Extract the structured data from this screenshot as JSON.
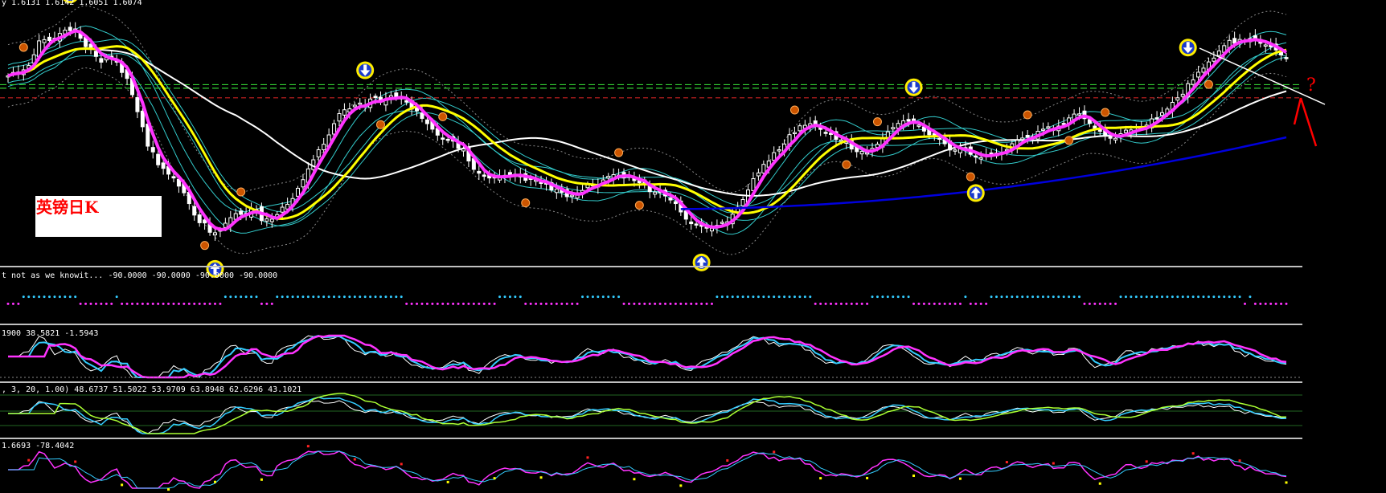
{
  "header": {
    "main_readout": "y  1.6131 1.6142 1.6051 1.6074",
    "chart_label": "英镑日K",
    "question_mark": "?"
  },
  "panes": {
    "p1": "t not as we knowit...  -90.0000 -90.0000 -90.0000 -90.0000",
    "p2": "1900 38.5821 -1.5943",
    "p3": ", 3, 20, 1.00) 48.6737 51.5022 53.9709 63.8948 62.6296 43.1021",
    "p4": "1.6693 -78.4042"
  },
  "colors": {
    "background": "#000000",
    "candle": "#ffffff",
    "ma_magenta": "#ff33ff",
    "ma_yellow": "#ffff00",
    "ma_white": "#ffffff",
    "ma_blue": "#0000dd",
    "band_cyan": "#33cccc",
    "band_gray": "#888888",
    "level_green": "#33cc33",
    "level_red": "#cc2222",
    "separator": "#c0c0c0",
    "arrow_fill": "#1a3acc",
    "arrow_ring": "#ffee00",
    "signal_red": "#ff2222"
  },
  "chart_data": {
    "type": "line",
    "title": "英镑日K",
    "header_values": {
      "open": 1.6131,
      "high": 1.6142,
      "low": 1.6051,
      "close": 1.6074
    },
    "x": [
      0,
      1,
      2,
      3,
      4,
      5,
      6,
      7,
      8,
      9,
      10,
      11,
      12,
      13,
      14,
      15,
      16,
      17,
      18,
      19,
      20,
      21,
      22,
      23,
      24,
      25,
      26,
      27,
      28,
      29,
      30,
      31,
      32,
      33,
      34,
      35,
      36,
      37,
      38,
      39,
      40,
      41,
      42,
      43,
      44,
      45,
      46,
      47,
      48,
      49,
      50,
      51,
      52,
      53,
      54,
      55,
      56,
      57,
      58,
      59,
      60,
      61,
      62,
      63,
      64,
      65,
      66,
      67,
      68,
      69,
      70,
      71,
      72,
      73,
      74,
      75,
      76,
      77,
      78,
      79,
      80,
      81,
      82,
      83,
      84,
      85,
      86,
      87,
      88,
      89,
      90,
      91,
      92,
      93,
      94,
      95,
      96,
      97,
      98,
      99,
      100,
      101,
      102,
      103,
      104,
      105,
      106,
      107,
      108,
      109,
      110,
      111,
      112,
      113,
      114,
      115,
      116,
      117,
      118,
      119,
      120,
      121,
      122,
      123,
      124,
      125,
      126,
      127,
      128,
      129,
      130,
      131,
      132,
      133,
      134,
      135,
      136,
      137,
      138,
      139,
      140,
      141,
      142,
      143,
      144,
      145,
      146,
      147,
      148,
      149,
      150,
      151,
      152,
      153,
      154,
      155,
      156,
      157,
      158,
      159,
      160,
      161,
      162,
      163,
      164,
      165,
      166,
      167,
      168,
      169,
      170,
      171,
      172,
      173,
      174,
      175,
      176,
      177,
      178,
      179,
      180,
      181,
      182,
      183,
      184,
      185,
      186,
      187,
      188,
      189,
      190,
      191,
      192,
      193,
      194,
      195,
      196,
      197,
      198,
      199,
      200,
      201,
      202,
      203,
      204,
      205,
      206,
      207,
      208,
      209,
      210,
      211,
      212,
      213,
      214,
      215,
      216,
      217,
      218,
      219,
      220,
      221,
      222,
      223,
      224,
      225,
      226,
      227,
      228,
      229,
      230,
      231,
      232,
      233,
      234,
      235,
      236,
      237,
      238,
      239,
      240,
      241,
      242,
      243,
      244,
      245,
      246,
      247,
      248,
      249,
      250,
      251,
      252,
      253,
      254,
      255,
      256,
      257,
      258,
      259
    ],
    "close": [
      0.757,
      0.771,
      0.773,
      0.782,
      0.8,
      0.845,
      0.903,
      0.908,
      0.904,
      0.914,
      0.934,
      0.948,
      0.946,
      0.953,
      0.914,
      0.879,
      0.867,
      0.838,
      0.814,
      0.833,
      0.83,
      0.819,
      0.771,
      0.746,
      0.678,
      0.607,
      0.544,
      0.463,
      0.439,
      0.385,
      0.37,
      0.346,
      0.33,
      0.296,
      0.268,
      0.223,
      0.175,
      0.143,
      0.142,
      0.103,
      0.101,
      0.114,
      0.141,
      0.164,
      0.181,
      0.178,
      0.178,
      0.2,
      0.198,
      0.152,
      0.159,
      0.158,
      0.177,
      0.208,
      0.22,
      0.244,
      0.287,
      0.323,
      0.368,
      0.406,
      0.448,
      0.471,
      0.51,
      0.557,
      0.599,
      0.615,
      0.619,
      0.634,
      0.643,
      0.629,
      0.66,
      0.666,
      0.647,
      0.661,
      0.674,
      0.67,
      0.664,
      0.647,
      0.618,
      0.611,
      0.579,
      0.557,
      0.534,
      0.509,
      0.492,
      0.491,
      0.484,
      0.454,
      0.452,
      0.401,
      0.366,
      0.35,
      0.337,
      0.33,
      0.333,
      0.338,
      0.341,
      0.337,
      0.346,
      0.344,
      0.32,
      0.324,
      0.321,
      0.308,
      0.304,
      0.28,
      0.284,
      0.27,
      0.252,
      0.258,
      0.268,
      0.278,
      0.305,
      0.302,
      0.3,
      0.322,
      0.337,
      0.344,
      0.342,
      0.33,
      0.341,
      0.319,
      0.31,
      0.302,
      0.273,
      0.271,
      0.27,
      0.255,
      0.238,
      0.223,
      0.188,
      0.158,
      0.139,
      0.133,
      0.128,
      0.12,
      0.12,
      0.132,
      0.145,
      0.147,
      0.179,
      0.208,
      0.24,
      0.28,
      0.327,
      0.351,
      0.387,
      0.401,
      0.436,
      0.448,
      0.472,
      0.511,
      0.52,
      0.548,
      0.55,
      0.557,
      0.546,
      0.533,
      0.516,
      0.512,
      0.491,
      0.489,
      0.48,
      0.451,
      0.44,
      0.441,
      0.435,
      0.454,
      0.471,
      0.497,
      0.523,
      0.541,
      0.558,
      0.569,
      0.567,
      0.558,
      0.551,
      0.526,
      0.511,
      0.508,
      0.492,
      0.473,
      0.447,
      0.447,
      0.453,
      0.449,
      0.429,
      0.418,
      0.415,
      0.428,
      0.433,
      0.434,
      0.434,
      0.449,
      0.473,
      0.488,
      0.497,
      0.5,
      0.503,
      0.525,
      0.534,
      0.544,
      0.533,
      0.547,
      0.556,
      0.581,
      0.597,
      0.598,
      0.578,
      0.558,
      0.532,
      0.525,
      0.51,
      0.496,
      0.496,
      0.515,
      0.53,
      0.531,
      0.53,
      0.54,
      0.551,
      0.577,
      0.581,
      0.603,
      0.618,
      0.646,
      0.665,
      0.68,
      0.724,
      0.74,
      0.772,
      0.789,
      0.815,
      0.831,
      0.861,
      0.883,
      0.905,
      0.893,
      0.909,
      0.904,
      0.913,
      0.907,
      0.893,
      0.886,
      0.878,
      0.865,
      0.844,
      0.832
    ],
    "ylim": [
      0,
      1
    ],
    "series_visible": [
      "candles",
      "magenta MA",
      "yellow MA",
      "white MA",
      "blue long MA",
      "cyan bands",
      "gray bands"
    ],
    "panes": 5,
    "grid": false,
    "legend": "none"
  }
}
